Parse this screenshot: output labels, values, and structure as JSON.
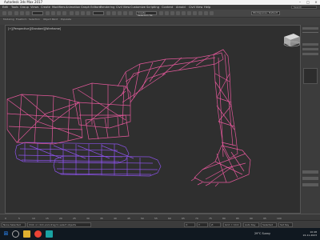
{
  "window": {
    "title": "Autodesk 3ds Max 2017"
  },
  "menu": {
    "items": [
      "Edit",
      "Tools",
      "Group",
      "Views",
      "Create",
      "Modifiers",
      "Animation",
      "Graph Editors",
      "Rendering",
      "Civil View",
      "Customize",
      "Scripting",
      "Content",
      "Arnold",
      "Civil View",
      "Help"
    ],
    "search_placeholder": "Search"
  },
  "toolbar": {
    "selection_set": "Create Selection Se",
    "workspace": "Workspaces: Default"
  },
  "ribbon": {
    "tabs": [
      "Modeling",
      "Freeform",
      "Selection",
      "Object Paint",
      "Populate"
    ]
  },
  "viewport": {
    "label": "[+][Perspective][Standard][Wireframe]"
  },
  "timeline": {
    "ticks": [
      "0",
      "5",
      "10",
      "15",
      "20",
      "25",
      "30",
      "35",
      "40",
      "45",
      "50",
      "55",
      "60",
      "65",
      "70",
      "75",
      "80",
      "85",
      "90",
      "95",
      "100"
    ]
  },
  "status": {
    "field1": "None Selected",
    "field2": "Click or click-and-drag to select objects",
    "x": "X:",
    "y": "Y:",
    "z": "Z:",
    "grid": "Grid = 10.0",
    "addkey": "Add Time Tag",
    "autokey": "Auto Key",
    "setkey": "Set Key",
    "selected": "Selected"
  },
  "taskbar": {
    "weather": "29°C Sunny",
    "time": "10:48",
    "date": "22-11-2023"
  },
  "colors": {
    "wire_pink": "#e3589a",
    "wire_purple": "#8a52e6",
    "viewport_bg": "#2f2f2f"
  }
}
